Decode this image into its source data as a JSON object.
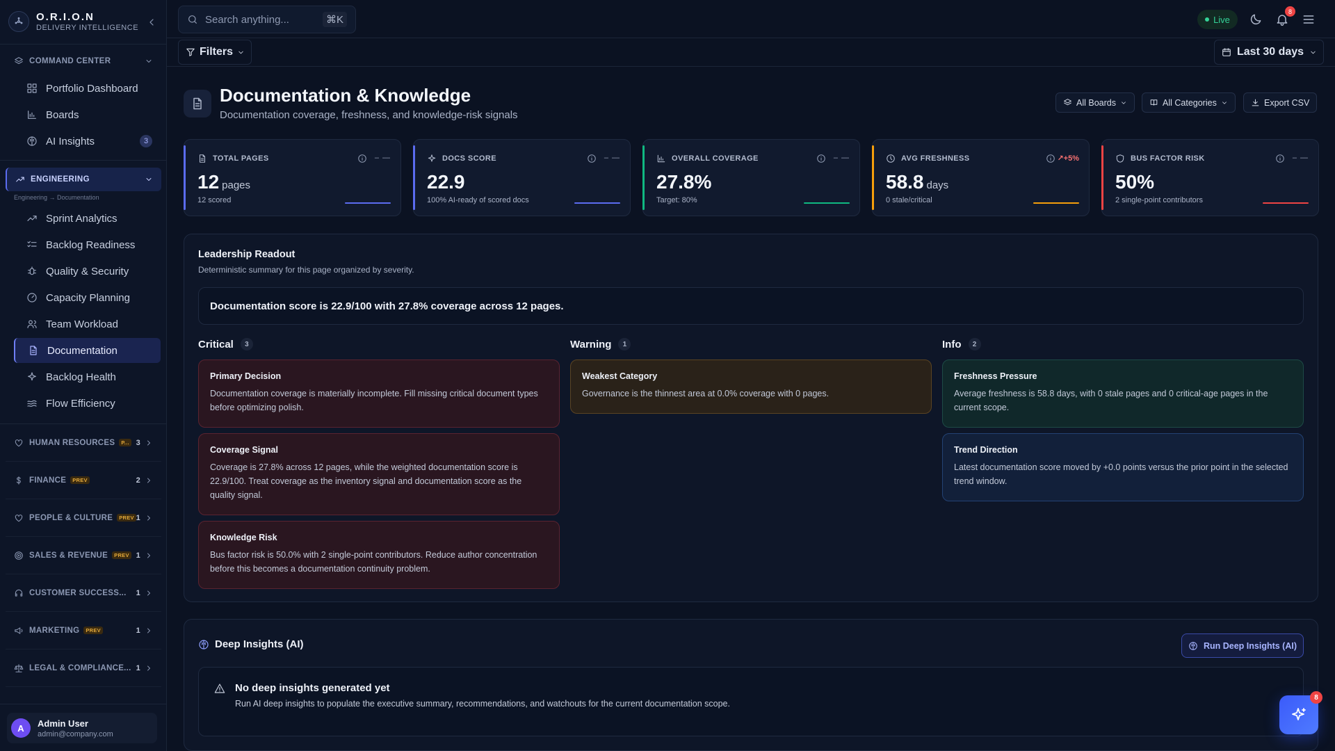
{
  "brand": {
    "name": "O.R.I.O.N",
    "subtitle": "DELIVERY INTELLIGENCE"
  },
  "sidebar": {
    "command_center": {
      "label": "COMMAND CENTER",
      "items": [
        {
          "label": "Portfolio Dashboard",
          "icon": "grid-icon"
        },
        {
          "label": "Boards",
          "icon": "bar-chart-icon"
        },
        {
          "label": "AI Insights",
          "icon": "brain-icon",
          "badge": "3"
        }
      ]
    },
    "engineering": {
      "label": "ENGINEERING",
      "breadcrumb": "Engineering → Documentation",
      "items": [
        {
          "label": "Sprint Analytics",
          "icon": "trend-icon"
        },
        {
          "label": "Backlog Readiness",
          "icon": "list-check-icon"
        },
        {
          "label": "Quality & Security",
          "icon": "bug-icon"
        },
        {
          "label": "Capacity Planning",
          "icon": "gauge-icon"
        },
        {
          "label": "Team Workload",
          "icon": "users-icon"
        },
        {
          "label": "Documentation",
          "icon": "file-icon",
          "active": true
        },
        {
          "label": "Backlog Health",
          "icon": "sparkle-icon"
        },
        {
          "label": "Flow Efficiency",
          "icon": "waves-icon"
        }
      ]
    },
    "departments": [
      {
        "label": "HUMAN RESOURCES",
        "badge": "P...",
        "count": "3",
        "icon": "heart-icon"
      },
      {
        "label": "FINANCE",
        "badge": "PREV",
        "count": "2",
        "icon": "dollar-icon"
      },
      {
        "label": "PEOPLE & CULTURE",
        "badge": "PREV",
        "count": "1",
        "icon": "heart-icon"
      },
      {
        "label": "SALES & REVENUE",
        "badge": "PREV",
        "count": "1",
        "icon": "target-icon"
      },
      {
        "label": "CUSTOMER SUCCESS...",
        "badge": "",
        "count": "1",
        "icon": "headset-icon"
      },
      {
        "label": "MARKETING",
        "badge": "PREV",
        "count": "1",
        "icon": "megaphone-icon"
      },
      {
        "label": "LEGAL & COMPLIANCE...",
        "badge": "",
        "count": "1",
        "icon": "scale-icon"
      }
    ],
    "user": {
      "initial": "A",
      "name": "Admin User",
      "email": "admin@company.com"
    }
  },
  "topbar": {
    "search_placeholder": "Search anything...",
    "shortcut": "⌘K",
    "live_label": "Live",
    "notification_count": "8"
  },
  "filterbar": {
    "filters_label": "Filters",
    "range_label": "Last 30 days"
  },
  "header": {
    "title": "Documentation & Knowledge",
    "subtitle": "Documentation coverage, freshness, and knowledge-risk signals",
    "boards_label": "All Boards",
    "categories_label": "All Categories",
    "export_label": "Export CSV"
  },
  "kpis": [
    {
      "label": "TOTAL PAGES",
      "value": "12",
      "unit": "pages",
      "note": "12 scored",
      "trend": "– —",
      "accent": "#5b6cf0",
      "icon": "file-icon"
    },
    {
      "label": "DOCS SCORE",
      "value": "22.9",
      "unit": "",
      "note": "100% AI-ready of scored docs",
      "trend": "– —",
      "accent": "#5b6cf0",
      "icon": "sparkle-icon"
    },
    {
      "label": "OVERALL COVERAGE",
      "value": "27.8%",
      "unit": "",
      "note": "Target: 80%",
      "trend": "– —",
      "accent": "#10b981",
      "icon": "bar-chart-icon"
    },
    {
      "label": "AVG FRESHNESS",
      "value": "58.8",
      "unit": "days",
      "note": "0 stale/critical",
      "trend": "↗+5%",
      "accent": "#f59e0b",
      "icon": "clock-icon"
    },
    {
      "label": "BUS FACTOR RISK",
      "value": "50%",
      "unit": "",
      "note": "2 single-point contributors",
      "trend": "– —",
      "accent": "#ef4444",
      "icon": "shield-icon"
    }
  ],
  "readout": {
    "title": "Leadership Readout",
    "subtitle": "Deterministic summary for this page organized by severity.",
    "summary": "Documentation score is 22.9/100 with 27.8% coverage across 12 pages.",
    "critical": {
      "label": "Critical",
      "count": "3",
      "cards": [
        {
          "title": "Primary Decision",
          "body": "Documentation coverage is materially incomplete. Fill missing critical document types before optimizing polish."
        },
        {
          "title": "Coverage Signal",
          "body": "Coverage is 27.8% across 12 pages, while the weighted documentation score is 22.9/100. Treat coverage as the inventory signal and documentation score as the quality signal."
        },
        {
          "title": "Knowledge Risk",
          "body": "Bus factor risk is 50.0% with 2 single-point contributors. Reduce author concentration before this becomes a documentation continuity problem."
        }
      ]
    },
    "warning": {
      "label": "Warning",
      "count": "1",
      "cards": [
        {
          "title": "Weakest Category",
          "body": "Governance is the thinnest area at 0.0% coverage with 0 pages."
        }
      ]
    },
    "info": {
      "label": "Info",
      "count": "2",
      "cards": [
        {
          "title": "Freshness Pressure",
          "body": "Average freshness is 58.8 days, with 0 stale pages and 0 critical-age pages in the current scope."
        },
        {
          "title": "Trend Direction",
          "body": "Latest documentation score moved by +0.0 points versus the prior point in the selected trend window."
        }
      ]
    }
  },
  "deep": {
    "title": "Deep Insights (AI)",
    "run_label": "Run Deep Insights (AI)",
    "empty_title": "No deep insights generated yet",
    "empty_body": "Run AI deep insights to populate the executive summary, recommendations, and watchouts for the current documentation scope."
  },
  "fab": {
    "badge": "8"
  }
}
